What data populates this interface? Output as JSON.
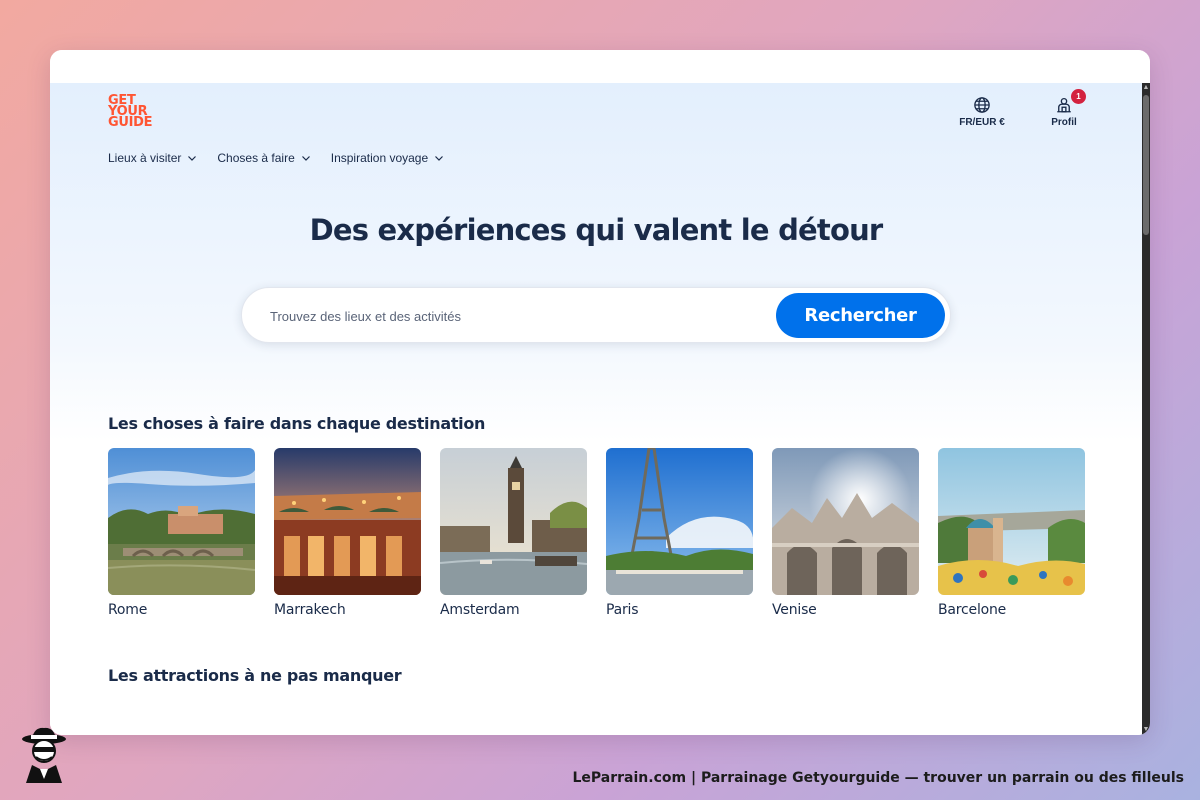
{
  "app": {
    "logo_lines": [
      "GET",
      "YOUR",
      "GUIDE"
    ]
  },
  "header": {
    "language_label": "FR/EUR €",
    "profile_label": "Profil",
    "profile_badge": "1",
    "nav": [
      {
        "label": "Lieux à visiter",
        "icon": "chevron-down-icon"
      },
      {
        "label": "Choses à faire",
        "icon": "chevron-down-icon"
      },
      {
        "label": "Inspiration voyage",
        "icon": "chevron-down-icon"
      }
    ]
  },
  "hero": {
    "title": "Des expériences qui valent le détour",
    "search_placeholder": "Trouvez des lieux et des activités",
    "search_button": "Rechercher"
  },
  "destinations": {
    "title": "Les choses à faire dans chaque destination",
    "items": [
      {
        "name": "Rome"
      },
      {
        "name": "Marrakech"
      },
      {
        "name": "Amsterdam"
      },
      {
        "name": "Paris"
      },
      {
        "name": "Venise"
      },
      {
        "name": "Barcelone"
      }
    ]
  },
  "attractions": {
    "title": "Les attractions à ne pas manquer"
  },
  "footer": {
    "caption": "LeParrain.com | Parrainage Getyourguide — trouver un parrain ou des filleuls"
  },
  "colors": {
    "brand_orange": "#ff5533",
    "primary_blue": "#0071eb",
    "text_navy": "#1a2b49",
    "badge_red": "#d3223f"
  }
}
